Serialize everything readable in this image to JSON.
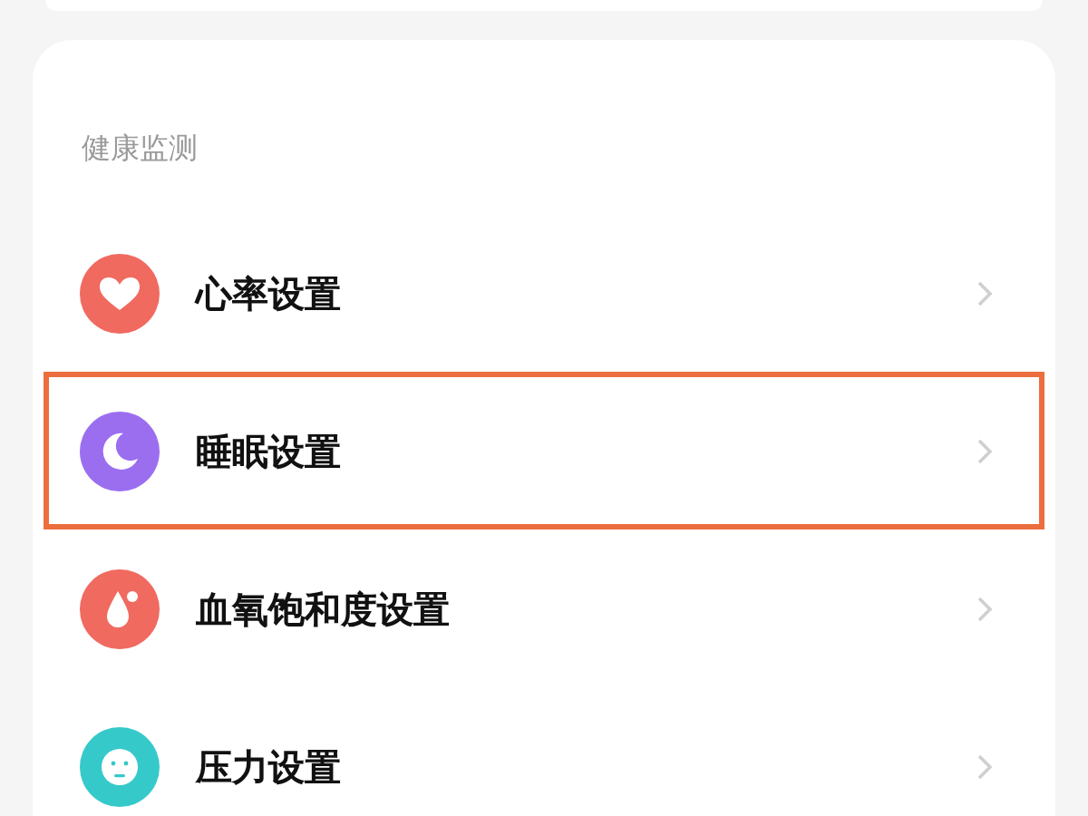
{
  "section": {
    "title": "健康监测"
  },
  "items": [
    {
      "label": "心率设置",
      "kind": "heart",
      "color": "#f06a60",
      "highlighted": false
    },
    {
      "label": "睡眠设置",
      "kind": "moon",
      "color": "#9b6ef0",
      "highlighted": true
    },
    {
      "label": "血氧饱和度设置",
      "kind": "drop",
      "color": "#f06a60",
      "highlighted": false
    },
    {
      "label": "压力设置",
      "kind": "face",
      "color": "#36c9c9",
      "highlighted": false
    }
  ]
}
